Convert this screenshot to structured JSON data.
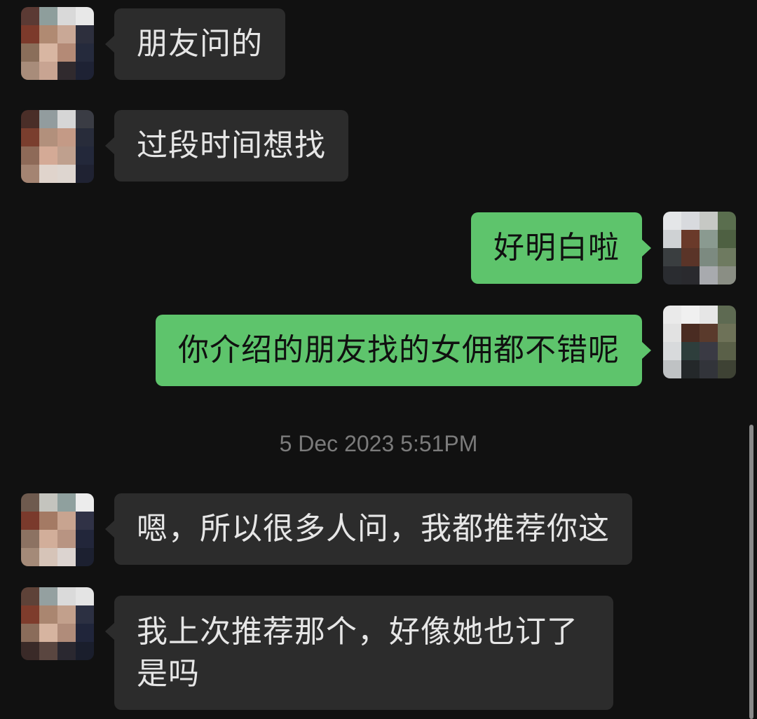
{
  "messages": [
    {
      "side": "in",
      "text": "朋友问的",
      "avatar": "contact-avatar"
    },
    {
      "side": "in",
      "text": "过段时间想找",
      "avatar": "contact-avatar"
    },
    {
      "side": "out",
      "text": "好明白啦",
      "avatar": "self-avatar"
    },
    {
      "side": "out",
      "text": "你介绍的朋友找的女佣都不错呢",
      "avatar": "self-avatar"
    },
    {
      "side": "in",
      "text": "嗯，所以很多人问，我都推荐你这",
      "avatar": "contact-avatar"
    },
    {
      "side": "in",
      "text": "我上次推荐那个，好像她也订了是吗",
      "avatar": "contact-avatar"
    }
  ],
  "timestamp": "5 Dec 2023 5:51PM",
  "colors": {
    "background": "#111111",
    "incoming_bubble": "#2c2c2c",
    "outgoing_bubble": "#5ec46c",
    "timestamp_text": "#7b7b7b"
  }
}
